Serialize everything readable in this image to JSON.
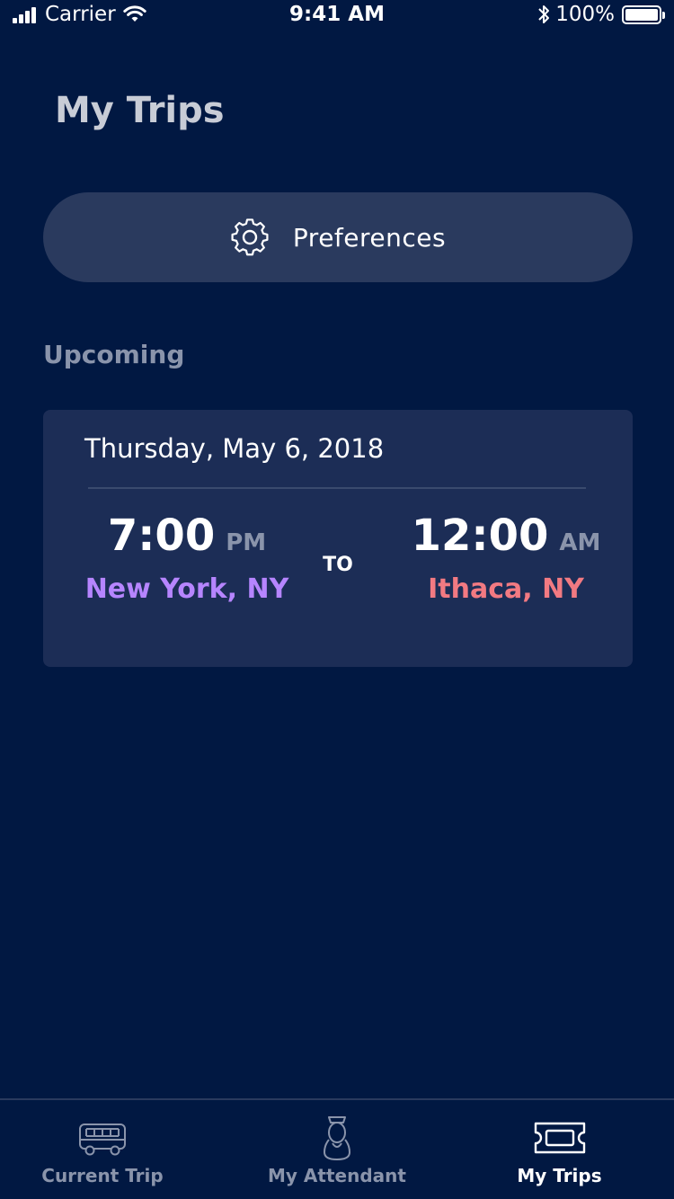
{
  "status_bar": {
    "carrier": "Carrier",
    "time": "9:41 AM",
    "battery": "100%"
  },
  "header": {
    "title": "My Trips"
  },
  "preferences": {
    "label": "Preferences",
    "icon": "gear-icon"
  },
  "upcoming": {
    "section_label": "Upcoming",
    "trips": [
      {
        "date": "Thursday, May 6, 2018",
        "depart_time": "7:00",
        "depart_ampm": "PM",
        "depart_city": "New York, NY",
        "connector": "TO",
        "arrive_time": "12:00",
        "arrive_ampm": "AM",
        "arrive_city": "Ithaca, NY"
      }
    ]
  },
  "tab_bar": {
    "tabs": [
      {
        "label": "Current Trip",
        "icon": "bus-icon",
        "active": false
      },
      {
        "label": "My Attendant",
        "icon": "attendant-icon",
        "active": false
      },
      {
        "label": "My Trips",
        "icon": "ticket-icon",
        "active": true
      }
    ]
  },
  "colors": {
    "background": "#011842",
    "card": "#1c2d56",
    "button": "#2a3a5e",
    "origin": "#b685ff",
    "destination": "#f27a82",
    "muted": "#8a94ab"
  }
}
